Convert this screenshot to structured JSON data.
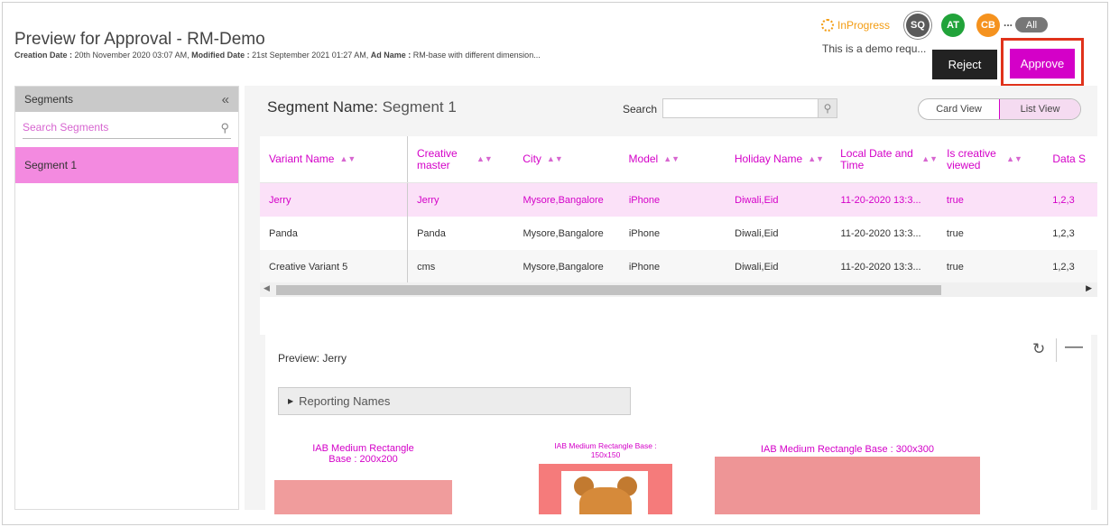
{
  "header": {
    "title": "Preview for Approval - RM-Demo",
    "meta": {
      "creation_label": "Creation Date :",
      "creation_value": "20th November 2020 03:07 AM,",
      "modified_label": "Modified Date :",
      "modified_value": "21st September 2021 01:27 AM,",
      "adname_label": "Ad Name :",
      "adname_value": "RM-base with different dimension..."
    },
    "status": "InProgress",
    "avatars": [
      "SQ",
      "AT",
      "CB"
    ],
    "more": "...",
    "all_label": "All",
    "demo_request": "This is a demo requ...",
    "reject_label": "Reject",
    "approve_label": "Approve"
  },
  "sidebar": {
    "title": "Segments",
    "collapse": "«",
    "search_placeholder": "Search Segments",
    "items": [
      {
        "label": "Segment 1"
      }
    ]
  },
  "main": {
    "segment_label": "Segment Name:",
    "segment_value": "Segment 1",
    "search_label": "Search",
    "card_view": "Card View",
    "list_view": "List View",
    "columns": [
      "Variant Name",
      "Creative master",
      "City",
      "Model",
      "Holiday Name",
      "Local Date and Time",
      "Is creative viewed",
      "Data S"
    ],
    "rows": [
      [
        "Jerry",
        "Jerry",
        "Mysore,Bangalore",
        "iPhone",
        "Diwali,Eid",
        "11-20-2020 13:3...",
        "true",
        "1,2,3"
      ],
      [
        "Panda",
        "Panda",
        "Mysore,Bangalore",
        "iPhone",
        "Diwali,Eid",
        "11-20-2020 13:3...",
        "true",
        "1,2,3"
      ],
      [
        "Creative Variant 5",
        "cms",
        "Mysore,Bangalore",
        "iPhone",
        "Diwali,Eid",
        "11-20-2020 13:3...",
        "true",
        "1,2,3"
      ]
    ]
  },
  "preview": {
    "title": "Preview: Jerry",
    "reporting_names": "Reporting Names",
    "ads": [
      {
        "label": "IAB Medium Rectangle Base : 200x200"
      },
      {
        "label": "IAB Medium Rectangle Base : 150x150"
      },
      {
        "label": "IAB Medium Rectangle Base : 300x300"
      }
    ]
  },
  "colors": {
    "accent": "#d400c8",
    "reject": "#222222",
    "highlight": "#e0321b"
  }
}
